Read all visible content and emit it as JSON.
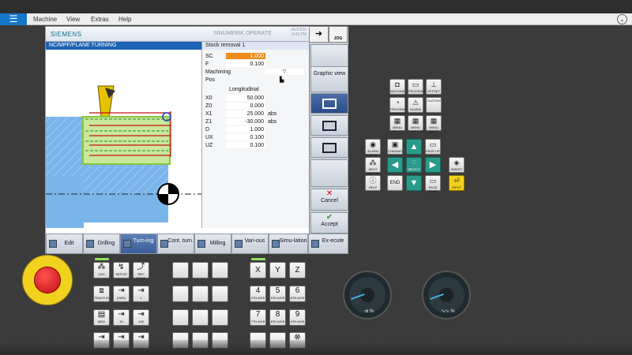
{
  "menubar": {
    "menu_icon": "hamburger-icon",
    "items": [
      "Machine",
      "View",
      "Extras",
      "Help"
    ]
  },
  "screen": {
    "brand": "SIEMENS",
    "product": "SINUMERIK OPERATE",
    "datetime_line1": "06/13/20",
    "datetime_line2": "8:00 PM",
    "path": "NC/MPF/PLANE TURNING",
    "form_title": "Stock removal 1",
    "params": {
      "sc_label": "SC",
      "sc_value": "1.000",
      "f_label": "F",
      "f_value": "0.100",
      "machining_label": "Machining",
      "machining_value": "▽",
      "pos_label": "Pos",
      "longitudinal": "Longitudinal",
      "x0_label": "X0",
      "x0_value": "50.000",
      "z0_label": "Z0",
      "z0_value": "0.000",
      "x1_label": "X1",
      "x1_value": "25.000",
      "x1_unit": "abs",
      "z1_label": "Z1",
      "z1_value": "-30.000",
      "z1_unit": "abs",
      "d_label": "D",
      "d_value": "1.000",
      "ux_label": "UX",
      "ux_value": "0.100",
      "uz_label": "UZ",
      "uz_value": "0.100"
    },
    "vertical_softkeys": {
      "graphic_view": "Graphic view",
      "cancel": "Cancel",
      "accept": "Accept"
    },
    "softkeys": [
      {
        "label": "Edit"
      },
      {
        "label": "Drilling"
      },
      {
        "label": "Turn-ing"
      },
      {
        "label": "Cont. turn."
      },
      {
        "label": "Milling"
      },
      {
        "label": "Vari-ous"
      },
      {
        "label": "Simu-lation"
      },
      {
        "label": "Ex-ecute"
      }
    ],
    "jog_label": "JOG"
  },
  "keypad": {
    "row1": [
      "MACHINE",
      "PROGRAM",
      "OFFSET"
    ],
    "row2": [
      "PROGRAM MANAGER",
      "ALARM",
      "CUSTOM"
    ],
    "row3": [
      "MENU SELECT",
      "MENU FUNCTION",
      "MENU BACK"
    ],
    "alarm_cancel": "ALARM CANCEL",
    "channel": "CHANNEL",
    "help": "HELP",
    "next_window": "NEXT WINDOW",
    "page_up": "PAGE UP",
    "page_down": "PAGE DOWN",
    "select": "SELECT",
    "end": "END",
    "insert": "INSERT",
    "input": "INPUT"
  },
  "machine_panel": {
    "jog_keys": [
      "JOG",
      "REPOS",
      "REF POINT"
    ],
    "teach_row": [
      "TEACH IN",
      "[VAR]",
      "1"
    ],
    "mda_row": [
      "MDA",
      "10",
      "100"
    ],
    "alpha": [
      "X",
      "Y",
      "Z"
    ],
    "num_row1": [
      "4",
      "5",
      "6"
    ],
    "num_row1_sub": [
      "4TH AXIS",
      "5TH AXIS",
      "6TH AXIS"
    ],
    "num_row2": [
      "7",
      "8",
      "9"
    ],
    "num_row2_sub": [
      "7TH AXIS",
      "8TH AXIS",
      "9TH AXIS"
    ],
    "feed_override_label": "%",
    "spindle_override_label": "%"
  }
}
